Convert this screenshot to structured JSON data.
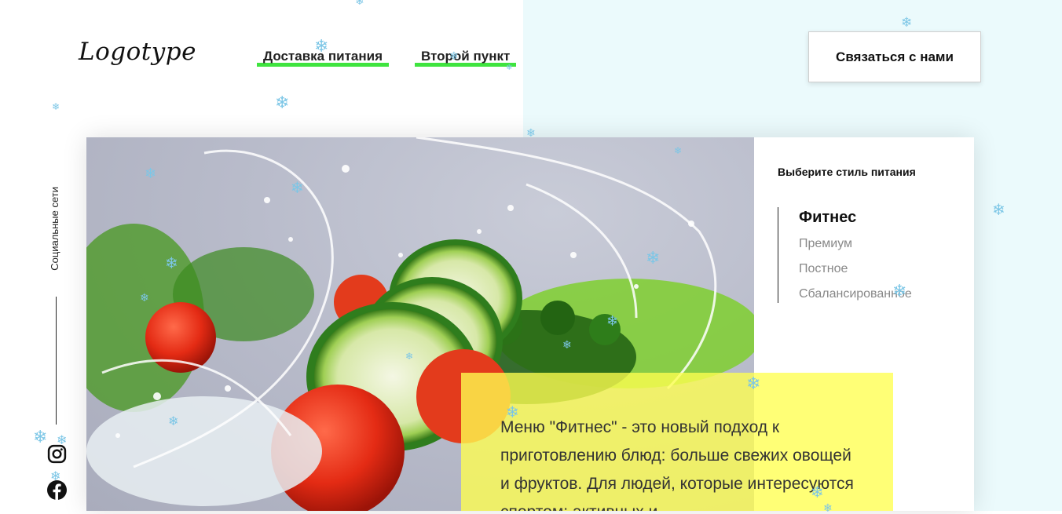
{
  "header": {
    "logo": "Logotype",
    "nav": [
      {
        "label": "Доставка питания"
      },
      {
        "label": "Второй пункт"
      }
    ],
    "contact_button": "Связаться с нами"
  },
  "social": {
    "label": "Социальные сети",
    "icons": [
      "instagram-icon",
      "facebook-icon"
    ]
  },
  "sidebar": {
    "title": "Выберите стиль питания",
    "items": [
      {
        "label": "Фитнес",
        "active": true
      },
      {
        "label": "Премиум",
        "active": false
      },
      {
        "label": "Постное",
        "active": false
      },
      {
        "label": "Сбалансированное",
        "active": false
      }
    ]
  },
  "description": {
    "text": "Меню \"Фитнес\" - это новый подход к приготовлению блюд: больше свежих овощей и фруктов. Для людей, которые интересуются спортом: активных и"
  },
  "colors": {
    "accent_green": "#3fe43f",
    "highlight_yellow": "#ffff50",
    "right_background": "#ebfafc",
    "snow": "#7cc6e6"
  }
}
